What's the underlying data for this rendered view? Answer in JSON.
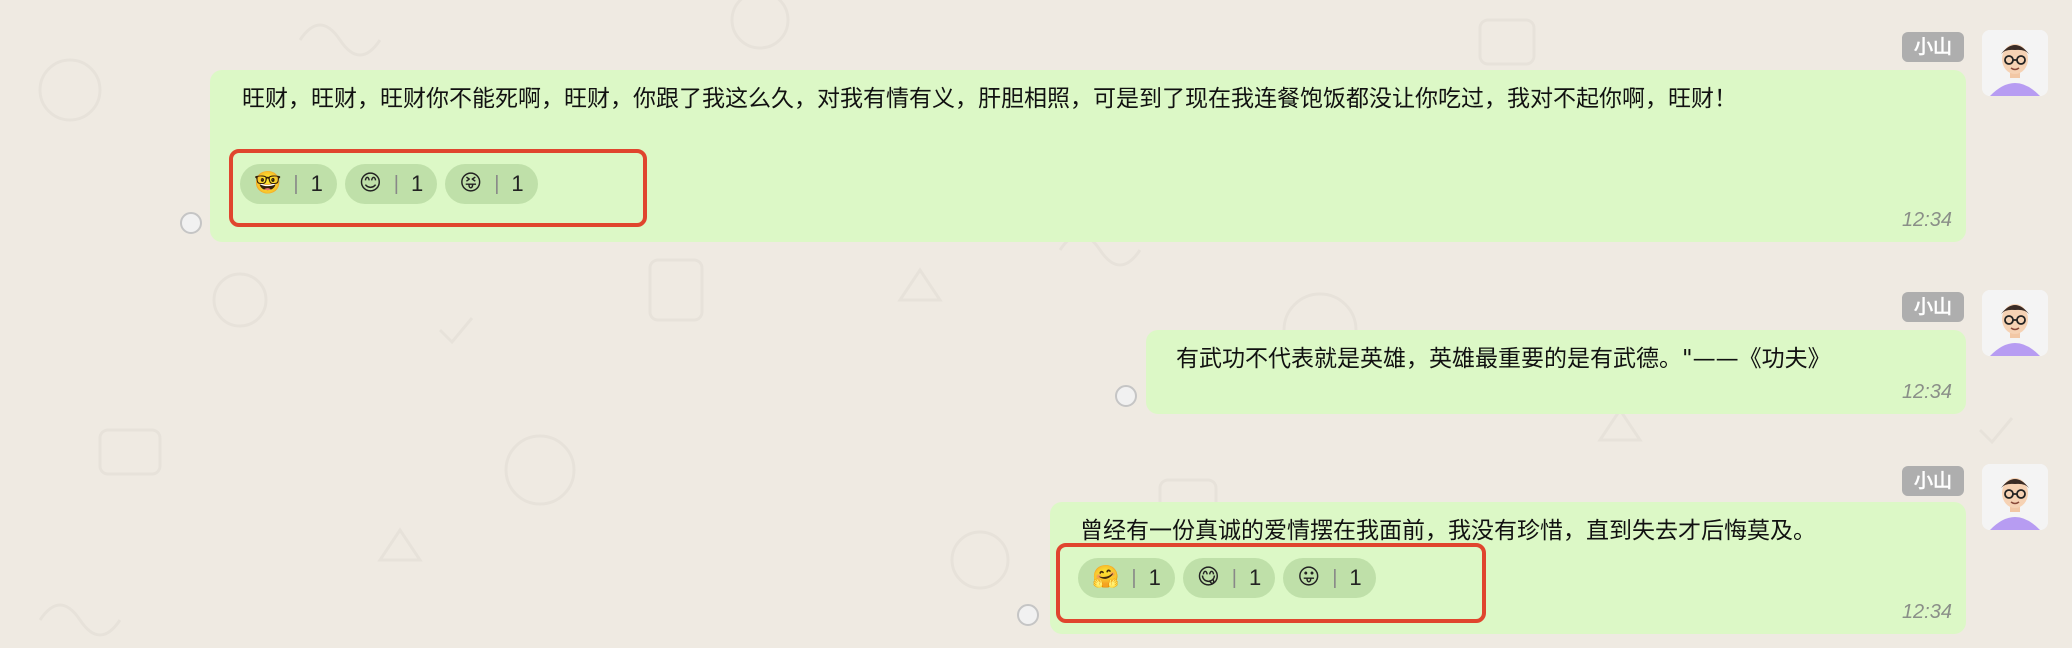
{
  "messages": [
    {
      "sender": "小山",
      "text": "旺财，旺财，旺财你不能死啊，旺财，你跟了我这么久，对我有情有义，肝胆相照，可是到了现在我连餐饱饭都没让你吃过，我对不起你啊，旺财！",
      "time": "12:34",
      "reactions": [
        {
          "emoji": "🤓",
          "count": "1"
        },
        {
          "emoji": "😊",
          "count": "1"
        },
        {
          "emoji": "😝",
          "count": "1"
        }
      ]
    },
    {
      "sender": "小山",
      "text": "有武功不代表就是英雄，英雄最重要的是有武德。\"——《功夫》",
      "time": "12:34",
      "reactions": []
    },
    {
      "sender": "小山",
      "text": "曾经有一份真诚的爱情摆在我面前，我没有珍惜，直到失去才后悔莫及。",
      "time": "12:34",
      "reactions": [
        {
          "emoji": "🤗",
          "count": "1"
        },
        {
          "emoji": "😋",
          "count": "1"
        },
        {
          "emoji": "😛",
          "count": "1"
        }
      ]
    }
  ],
  "colors": {
    "bubble": "#dcf8c6",
    "reaction_chip": "#bfe0a9",
    "highlight": "#e0452e",
    "background": "#efeae2"
  }
}
